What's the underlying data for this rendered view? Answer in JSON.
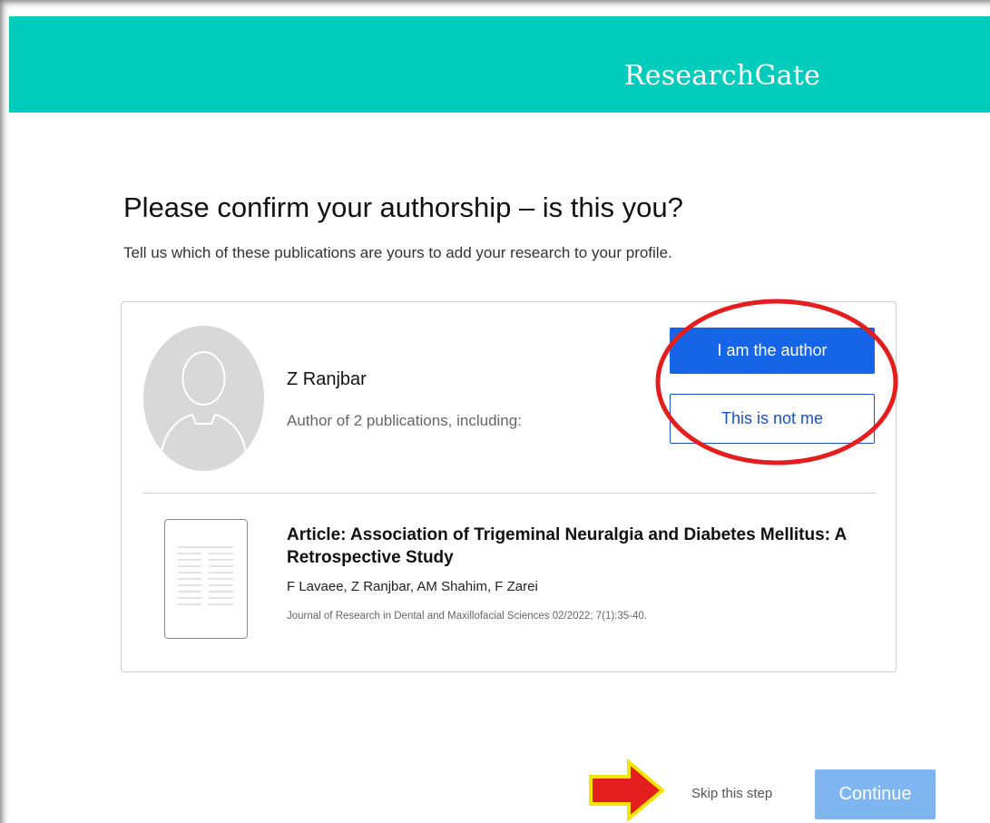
{
  "header": {
    "brand": "ResearchGate",
    "background_color": "#00ccbb"
  },
  "main": {
    "title": "Please confirm your authorship – is this you?",
    "subtitle": "Tell us which of these publications are yours to add your research to your profile."
  },
  "author_card": {
    "avatar_icon": "person-silhouette-icon",
    "name": "Z Ranjbar",
    "meta": "Author of 2 publications, including:",
    "confirm_label": "I am the author",
    "deny_label": "This is not me",
    "confirm_color": "#1565e6",
    "publication": {
      "thumbnail_icon": "document-icon",
      "title": "Article: Association of Trigeminal Neuralgia and Diabetes Mellitus: A Retrospective Study",
      "authors": "F Lavaee, Z Ranjbar, AM Shahim, F Zarei",
      "venue": "Journal of Research in Dental and Maxillofacial Sciences 02/2022; 7(1):35-40."
    }
  },
  "footer": {
    "skip_label": "Skip this step",
    "continue_label": "Continue",
    "continue_color": "#7fb5f1"
  },
  "annotations": {
    "ellipse_color": "#e41e1e",
    "arrow_fill": "#e41e1e",
    "arrow_outline": "#f5e400"
  }
}
